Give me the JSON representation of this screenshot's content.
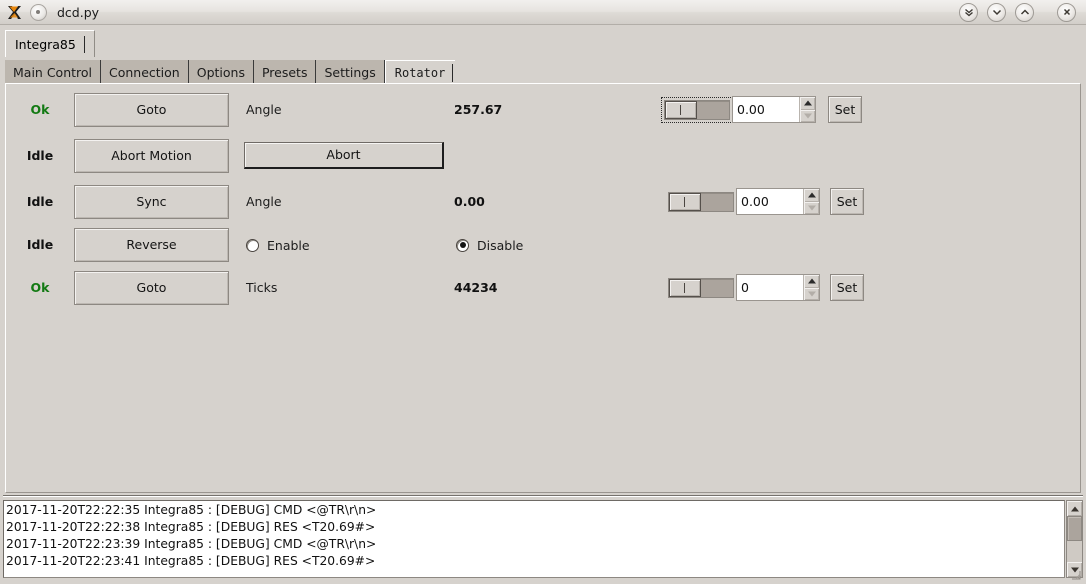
{
  "window": {
    "title": "dcd.py",
    "app_icon": "x11-logo-icon",
    "menu_icon": "window-menu-icon",
    "buttons": [
      {
        "name": "shade-button",
        "glyph": "double-chevron-down-icon"
      },
      {
        "name": "minimize-button",
        "glyph": "chevron-down-icon"
      },
      {
        "name": "maximize-button",
        "glyph": "chevron-up-icon"
      },
      {
        "name": "close-button",
        "glyph": "close-x-icon"
      }
    ]
  },
  "outer_tabs": [
    {
      "label": "Integra85",
      "selected": true
    }
  ],
  "inner_tabs": [
    {
      "label": "Main Control",
      "selected": false
    },
    {
      "label": "Connection",
      "selected": false
    },
    {
      "label": "Options",
      "selected": false
    },
    {
      "label": "Presets",
      "selected": false
    },
    {
      "label": "Settings",
      "selected": false
    },
    {
      "label": "Rotator",
      "selected": true
    }
  ],
  "rows": [
    {
      "status": "Ok",
      "status_kind": "ok",
      "button": "Goto",
      "label": "Angle",
      "value": "257.67",
      "slider": {
        "focused": true,
        "handle_pct": 0
      },
      "spin_value": "0.00",
      "set_label": "Set"
    },
    {
      "status": "Idle",
      "status_kind": "idle",
      "button": "Abort Motion",
      "abort_label": "Abort"
    },
    {
      "status": "Idle",
      "status_kind": "idle",
      "button": "Sync",
      "label": "Angle",
      "value": "0.00",
      "slider": {
        "focused": false,
        "handle_pct": 0
      },
      "spin_value": "0.00",
      "set_label": "Set"
    },
    {
      "status": "Idle",
      "status_kind": "idle",
      "button": "Reverse",
      "radios": [
        {
          "label": "Enable",
          "checked": false
        },
        {
          "label": "Disable",
          "checked": true
        }
      ]
    },
    {
      "status": "Ok",
      "status_kind": "ok",
      "button": "Goto",
      "label": "Ticks",
      "value": "44234",
      "slider": {
        "focused": false,
        "handle_pct": 0
      },
      "spin_value": "0",
      "set_label": "Set"
    }
  ],
  "log": {
    "lines": [
      "2017-11-20T22:22:35 Integra85 : [DEBUG] CMD <@TR\\r\\n>",
      "2017-11-20T22:22:38 Integra85 : [DEBUG] RES <T20.69#>",
      "2017-11-20T22:23:39 Integra85 : [DEBUG] CMD <@TR\\r\\n>",
      "2017-11-20T22:23:41 Integra85 : [DEBUG] RES <T20.69#>"
    ]
  },
  "colors": {
    "window_bg": "#d6d2cd",
    "status_ok": "#137a13",
    "status_idle": "#111111",
    "tab_unselected": "#bcb6ae"
  }
}
